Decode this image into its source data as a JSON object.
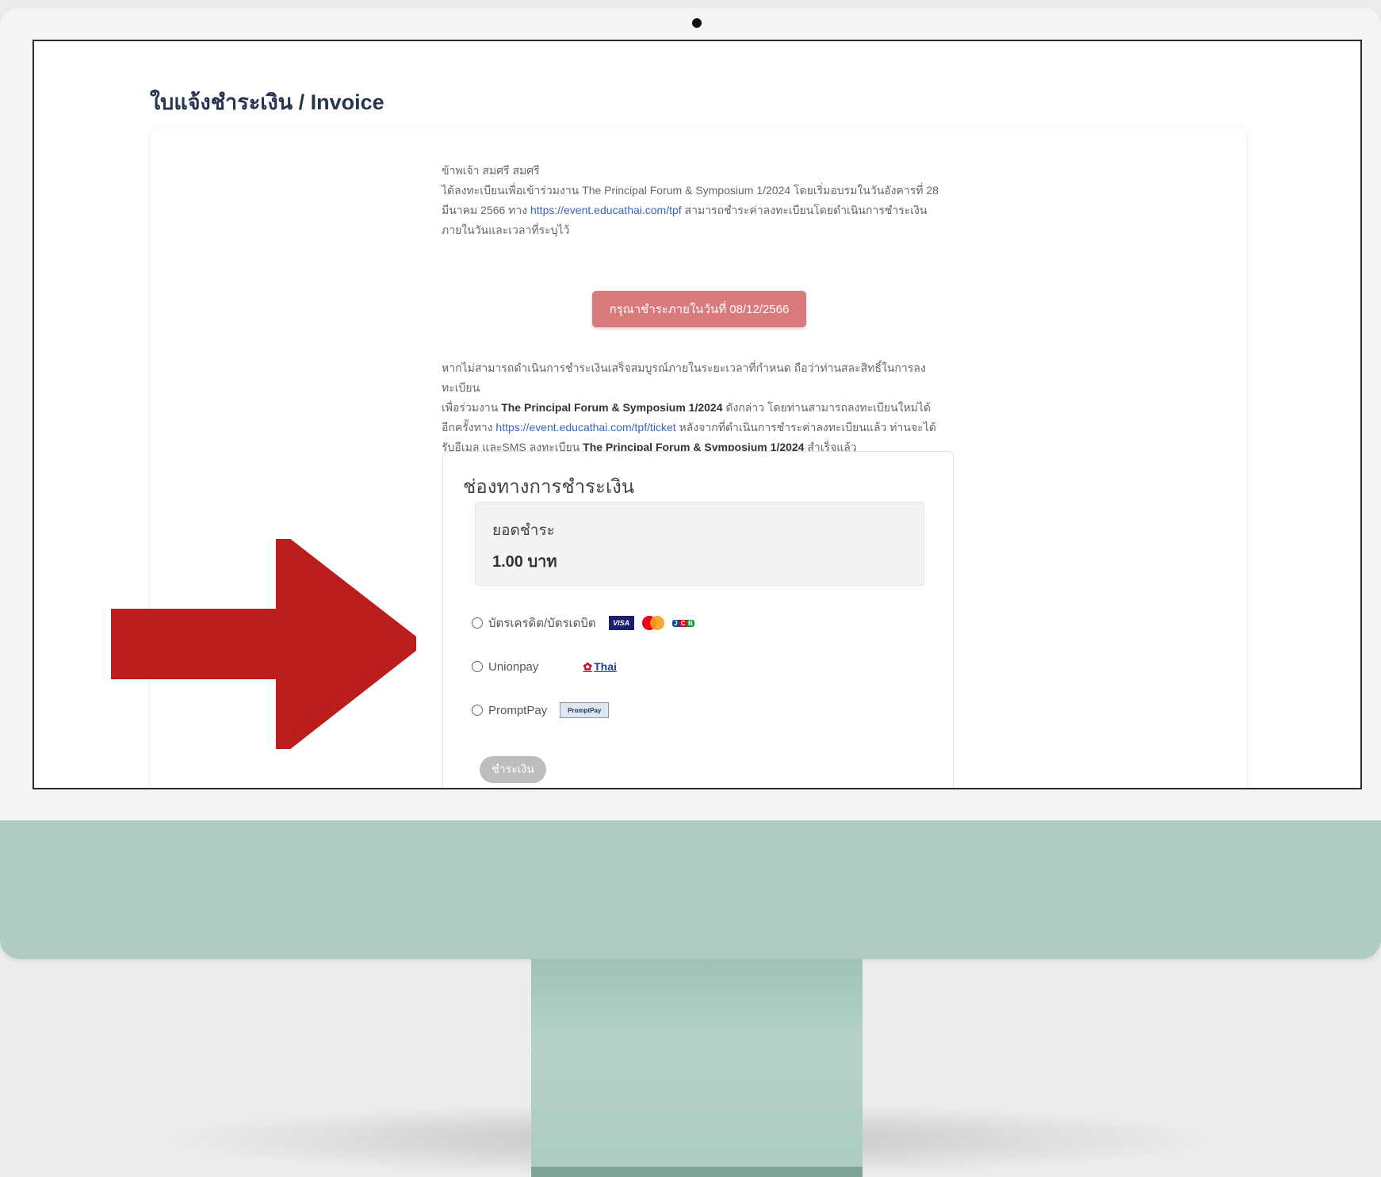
{
  "page": {
    "title": "ใบแจ้งชำระเงิน / Invoice"
  },
  "intro": {
    "line1": "ข้าพเจ้า สมศรี สมศรี",
    "line2": "ได้ลงทะเบียนเพื่อเข้าร่วมงาน The Principal Forum & Symposium 1/2024 โดยเริ่มอบรมในวันอังคารที่ 28",
    "line3_prefix": "มีนาคม 2566 ทาง ",
    "line3_link": "https://event.educathai.com/tpf",
    "line3_suffix": " สามารถชำระค่าลงทะเบียนโดยดำเนินการชำระเงิน",
    "line4": "ภายในวันและเวลาที่ระบุไว้"
  },
  "due_button": {
    "label": "กรุณาชำระภายในวันที่ 08/12/2566"
  },
  "note": {
    "l1": "หากไม่สามารถดำเนินการชำระเงินเสร็จสมบูรณ์ภายในระยะเวลาที่กำหนด ถือว่าท่านสละสิทธิ์ในการลงทะเบียน",
    "l2_prefix": "เพื่อร่วมงาน ",
    "l2_event": "The Principal Forum & Symposium 1/2024",
    "l2_suffix": " ดังกล่าว โดยท่านสามารถลงทะเบียนใหม่ได้",
    "l3_prefix": "อีกครั้งทาง ",
    "l3_link": "https://event.educathai.com/tpf/ticket",
    "l3_suffix": " หลังจากที่ดำเนินการชำระค่าลงทะเบียนแล้ว ท่านจะได้",
    "l4_prefix": "รับอีเมล และSMS ลงทะเบียน ",
    "l4_event": "The Principal Forum & Symposium 1/2024",
    "l4_suffix": " สำเร็จแล้ว"
  },
  "payment": {
    "title": "ช่องทางการชำระเงิน",
    "amount_label": "ยอดชำระ",
    "amount_value": "1.00 บาท",
    "options": [
      {
        "label": "บัตรเครดิต/บัตรเดบิต",
        "logos": [
          "visa",
          "mastercard",
          "jcb"
        ]
      },
      {
        "label": "Unionpay",
        "logos": [
          "unionpay",
          "thai"
        ]
      },
      {
        "label": "PromptPay",
        "logos": [
          "promptpay"
        ]
      }
    ],
    "logo_text": {
      "visa": "VISA",
      "jcb_j": "J",
      "jcb_c": "C",
      "jcb_b": "B",
      "thai": "Thai",
      "promptpay": "PromptPay"
    },
    "pay_button": "ชำระเงิน"
  },
  "colors": {
    "title": "#27344d",
    "due_button": "#d97a7c",
    "link": "#3b63b8",
    "arrow": "#bb1c1c",
    "imac_chin": "#b0ccc2",
    "pay_button_disabled": "#bdbdbd"
  }
}
